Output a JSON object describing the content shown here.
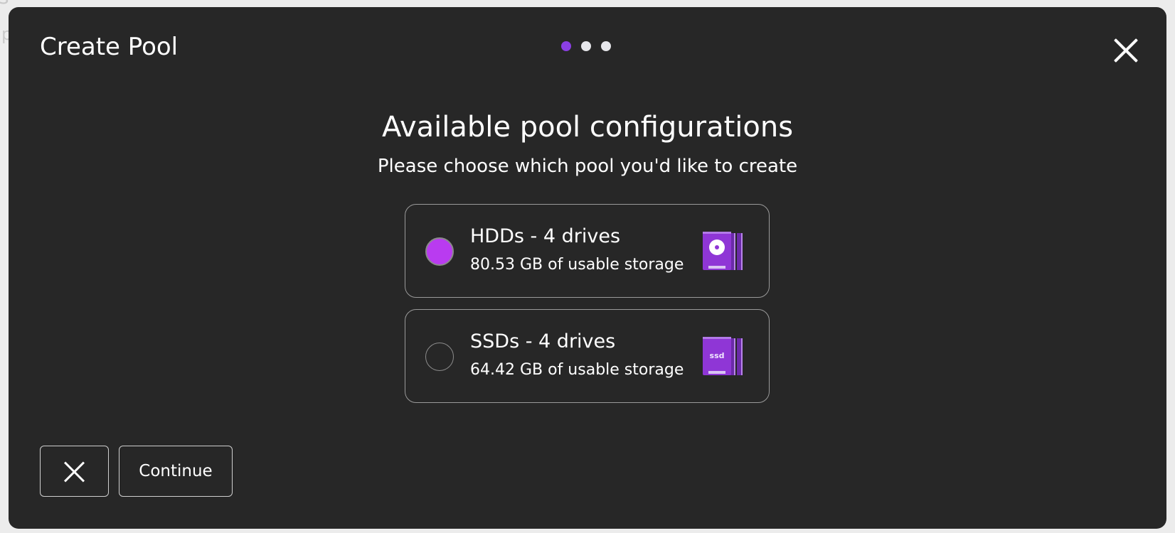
{
  "background": {
    "fragment_1": "s",
    "fragment_2": "p"
  },
  "modal": {
    "title": "Create Pool",
    "steps": {
      "total": 3,
      "current": 1
    },
    "heading": "Available pool configurations",
    "subheading": "Please choose which pool you'd like to create",
    "options": [
      {
        "title": "HDDs - 4 drives",
        "subtitle": "80.53 GB of usable storage",
        "selected": true,
        "icon": "hdd-stack-icon"
      },
      {
        "title": "SSDs - 4 drives",
        "subtitle": "64.42 GB of usable storage",
        "selected": false,
        "icon": "ssd-stack-icon",
        "icon_label": "ssd"
      }
    ],
    "footer": {
      "continue_label": "Continue"
    }
  },
  "colors": {
    "modal_bg": "#272727",
    "accent": "#8b3fe3",
    "radio_selected": "#b93bf0",
    "drive_icon": "#8f36d6"
  }
}
